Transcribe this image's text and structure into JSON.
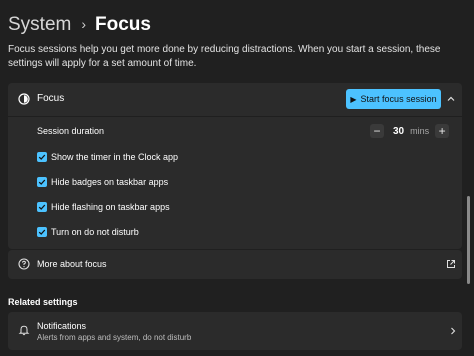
{
  "breadcrumb": {
    "parent": "System",
    "current": "Focus"
  },
  "description": "Focus sessions help you get more done by reducing distractions. When you start a session, these settings will apply for a set amount of time.",
  "focus": {
    "title": "Focus",
    "start_button": "Start focus session",
    "session_duration": {
      "label": "Session duration",
      "value": "30",
      "unit": "mins",
      "decrement": "−",
      "increment": "+"
    },
    "options": [
      {
        "label": "Show the timer in the Clock app",
        "checked": true
      },
      {
        "label": "Hide badges on taskbar apps",
        "checked": true
      },
      {
        "label": "Hide flashing on taskbar apps",
        "checked": true
      },
      {
        "label": "Turn on do not disturb",
        "checked": true
      }
    ]
  },
  "more_about": {
    "label": "More about focus"
  },
  "related": {
    "title": "Related settings",
    "notifications": {
      "title": "Notifications",
      "subtitle": "Alerts from apps and system, do not disturb"
    }
  },
  "colors": {
    "accent": "#4cc2ff",
    "background": "#202020",
    "card": "#2b2b2b"
  },
  "icons": [
    "chevron-right-icon",
    "focus-clock-icon",
    "play-icon",
    "chevron-up-icon",
    "checkmark-icon",
    "help-icon",
    "external-link-icon",
    "bell-icon"
  ]
}
